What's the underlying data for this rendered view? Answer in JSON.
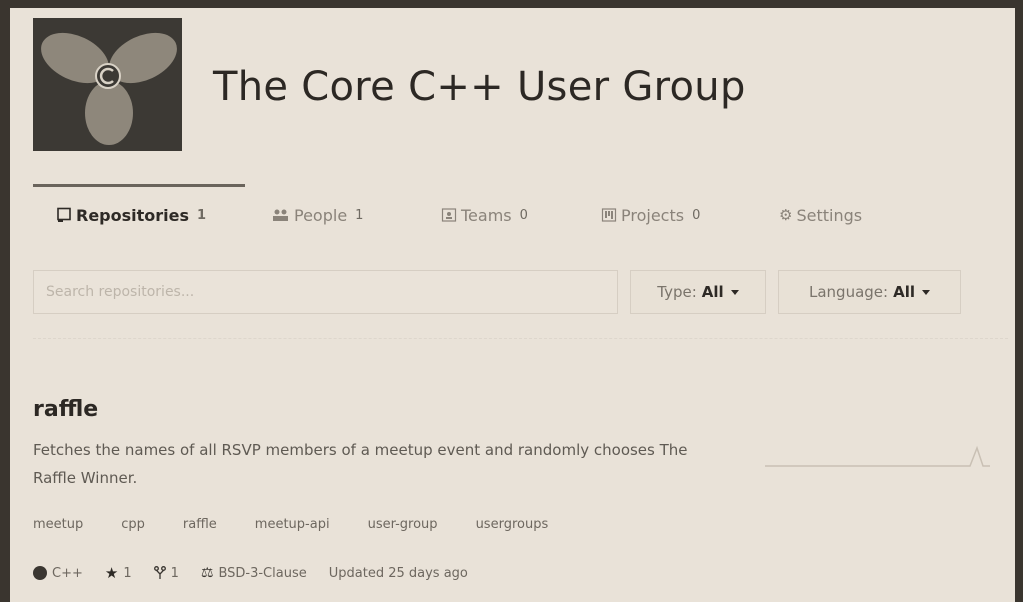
{
  "org": {
    "title": "The Core C++ User Group"
  },
  "tabs": [
    {
      "label": "Repositories",
      "count": "1",
      "icon": "repo-icon",
      "active": true
    },
    {
      "label": "People",
      "count": "1",
      "icon": "people-icon",
      "active": false
    },
    {
      "label": "Teams",
      "count": "0",
      "icon": "teams-icon",
      "active": false
    },
    {
      "label": "Projects",
      "count": "0",
      "icon": "projects-icon",
      "active": false
    },
    {
      "label": "Settings",
      "count": "",
      "icon": "gear-icon",
      "active": false
    }
  ],
  "search": {
    "placeholder": "Search repositories..."
  },
  "filters": {
    "type_label": "Type:",
    "type_value": "All",
    "language_label": "Language:",
    "language_value": "All"
  },
  "repo": {
    "name": "raffle",
    "description": "Fetches the names of all RSVP members of a meetup event and randomly chooses The Raffle Winner.",
    "topics": [
      "meetup",
      "cpp",
      "raffle",
      "meetup-api",
      "user-group",
      "usergroups"
    ],
    "language": "C++",
    "stars": "1",
    "forks": "1",
    "license": "BSD-3-Clause",
    "updated": "Updated 25 days ago"
  },
  "colors": {
    "background": "#e9e2d8",
    "text": "#2c2824",
    "muted": "#8a837a"
  }
}
